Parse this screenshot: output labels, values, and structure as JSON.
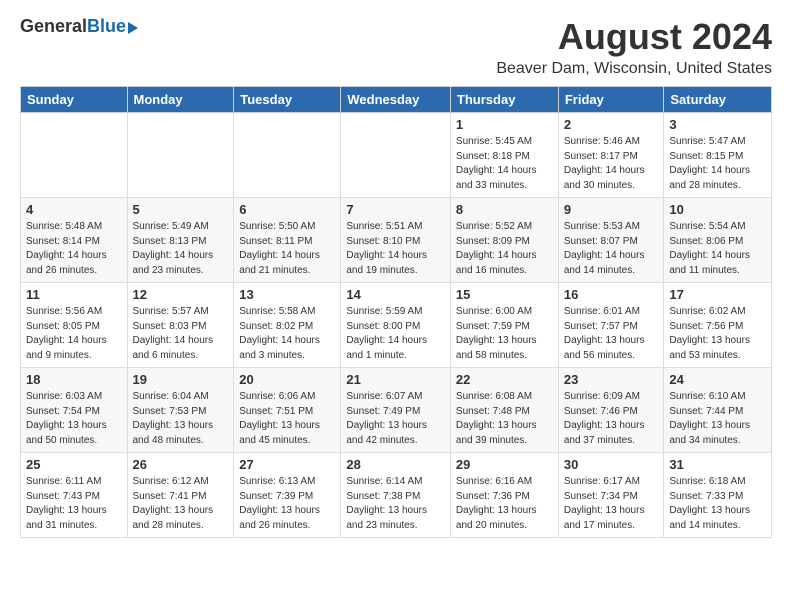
{
  "header": {
    "logo_general": "General",
    "logo_blue": "Blue",
    "month_year": "August 2024",
    "location": "Beaver Dam, Wisconsin, United States"
  },
  "weekdays": [
    "Sunday",
    "Monday",
    "Tuesday",
    "Wednesday",
    "Thursday",
    "Friday",
    "Saturday"
  ],
  "weeks": [
    [
      {
        "day": "",
        "info": ""
      },
      {
        "day": "",
        "info": ""
      },
      {
        "day": "",
        "info": ""
      },
      {
        "day": "",
        "info": ""
      },
      {
        "day": "1",
        "info": "Sunrise: 5:45 AM\nSunset: 8:18 PM\nDaylight: 14 hours\nand 33 minutes."
      },
      {
        "day": "2",
        "info": "Sunrise: 5:46 AM\nSunset: 8:17 PM\nDaylight: 14 hours\nand 30 minutes."
      },
      {
        "day": "3",
        "info": "Sunrise: 5:47 AM\nSunset: 8:15 PM\nDaylight: 14 hours\nand 28 minutes."
      }
    ],
    [
      {
        "day": "4",
        "info": "Sunrise: 5:48 AM\nSunset: 8:14 PM\nDaylight: 14 hours\nand 26 minutes."
      },
      {
        "day": "5",
        "info": "Sunrise: 5:49 AM\nSunset: 8:13 PM\nDaylight: 14 hours\nand 23 minutes."
      },
      {
        "day": "6",
        "info": "Sunrise: 5:50 AM\nSunset: 8:11 PM\nDaylight: 14 hours\nand 21 minutes."
      },
      {
        "day": "7",
        "info": "Sunrise: 5:51 AM\nSunset: 8:10 PM\nDaylight: 14 hours\nand 19 minutes."
      },
      {
        "day": "8",
        "info": "Sunrise: 5:52 AM\nSunset: 8:09 PM\nDaylight: 14 hours\nand 16 minutes."
      },
      {
        "day": "9",
        "info": "Sunrise: 5:53 AM\nSunset: 8:07 PM\nDaylight: 14 hours\nand 14 minutes."
      },
      {
        "day": "10",
        "info": "Sunrise: 5:54 AM\nSunset: 8:06 PM\nDaylight: 14 hours\nand 11 minutes."
      }
    ],
    [
      {
        "day": "11",
        "info": "Sunrise: 5:56 AM\nSunset: 8:05 PM\nDaylight: 14 hours\nand 9 minutes."
      },
      {
        "day": "12",
        "info": "Sunrise: 5:57 AM\nSunset: 8:03 PM\nDaylight: 14 hours\nand 6 minutes."
      },
      {
        "day": "13",
        "info": "Sunrise: 5:58 AM\nSunset: 8:02 PM\nDaylight: 14 hours\nand 3 minutes."
      },
      {
        "day": "14",
        "info": "Sunrise: 5:59 AM\nSunset: 8:00 PM\nDaylight: 14 hours\nand 1 minute."
      },
      {
        "day": "15",
        "info": "Sunrise: 6:00 AM\nSunset: 7:59 PM\nDaylight: 13 hours\nand 58 minutes."
      },
      {
        "day": "16",
        "info": "Sunrise: 6:01 AM\nSunset: 7:57 PM\nDaylight: 13 hours\nand 56 minutes."
      },
      {
        "day": "17",
        "info": "Sunrise: 6:02 AM\nSunset: 7:56 PM\nDaylight: 13 hours\nand 53 minutes."
      }
    ],
    [
      {
        "day": "18",
        "info": "Sunrise: 6:03 AM\nSunset: 7:54 PM\nDaylight: 13 hours\nand 50 minutes."
      },
      {
        "day": "19",
        "info": "Sunrise: 6:04 AM\nSunset: 7:53 PM\nDaylight: 13 hours\nand 48 minutes."
      },
      {
        "day": "20",
        "info": "Sunrise: 6:06 AM\nSunset: 7:51 PM\nDaylight: 13 hours\nand 45 minutes."
      },
      {
        "day": "21",
        "info": "Sunrise: 6:07 AM\nSunset: 7:49 PM\nDaylight: 13 hours\nand 42 minutes."
      },
      {
        "day": "22",
        "info": "Sunrise: 6:08 AM\nSunset: 7:48 PM\nDaylight: 13 hours\nand 39 minutes."
      },
      {
        "day": "23",
        "info": "Sunrise: 6:09 AM\nSunset: 7:46 PM\nDaylight: 13 hours\nand 37 minutes."
      },
      {
        "day": "24",
        "info": "Sunrise: 6:10 AM\nSunset: 7:44 PM\nDaylight: 13 hours\nand 34 minutes."
      }
    ],
    [
      {
        "day": "25",
        "info": "Sunrise: 6:11 AM\nSunset: 7:43 PM\nDaylight: 13 hours\nand 31 minutes."
      },
      {
        "day": "26",
        "info": "Sunrise: 6:12 AM\nSunset: 7:41 PM\nDaylight: 13 hours\nand 28 minutes."
      },
      {
        "day": "27",
        "info": "Sunrise: 6:13 AM\nSunset: 7:39 PM\nDaylight: 13 hours\nand 26 minutes."
      },
      {
        "day": "28",
        "info": "Sunrise: 6:14 AM\nSunset: 7:38 PM\nDaylight: 13 hours\nand 23 minutes."
      },
      {
        "day": "29",
        "info": "Sunrise: 6:16 AM\nSunset: 7:36 PM\nDaylight: 13 hours\nand 20 minutes."
      },
      {
        "day": "30",
        "info": "Sunrise: 6:17 AM\nSunset: 7:34 PM\nDaylight: 13 hours\nand 17 minutes."
      },
      {
        "day": "31",
        "info": "Sunrise: 6:18 AM\nSunset: 7:33 PM\nDaylight: 13 hours\nand 14 minutes."
      }
    ]
  ]
}
